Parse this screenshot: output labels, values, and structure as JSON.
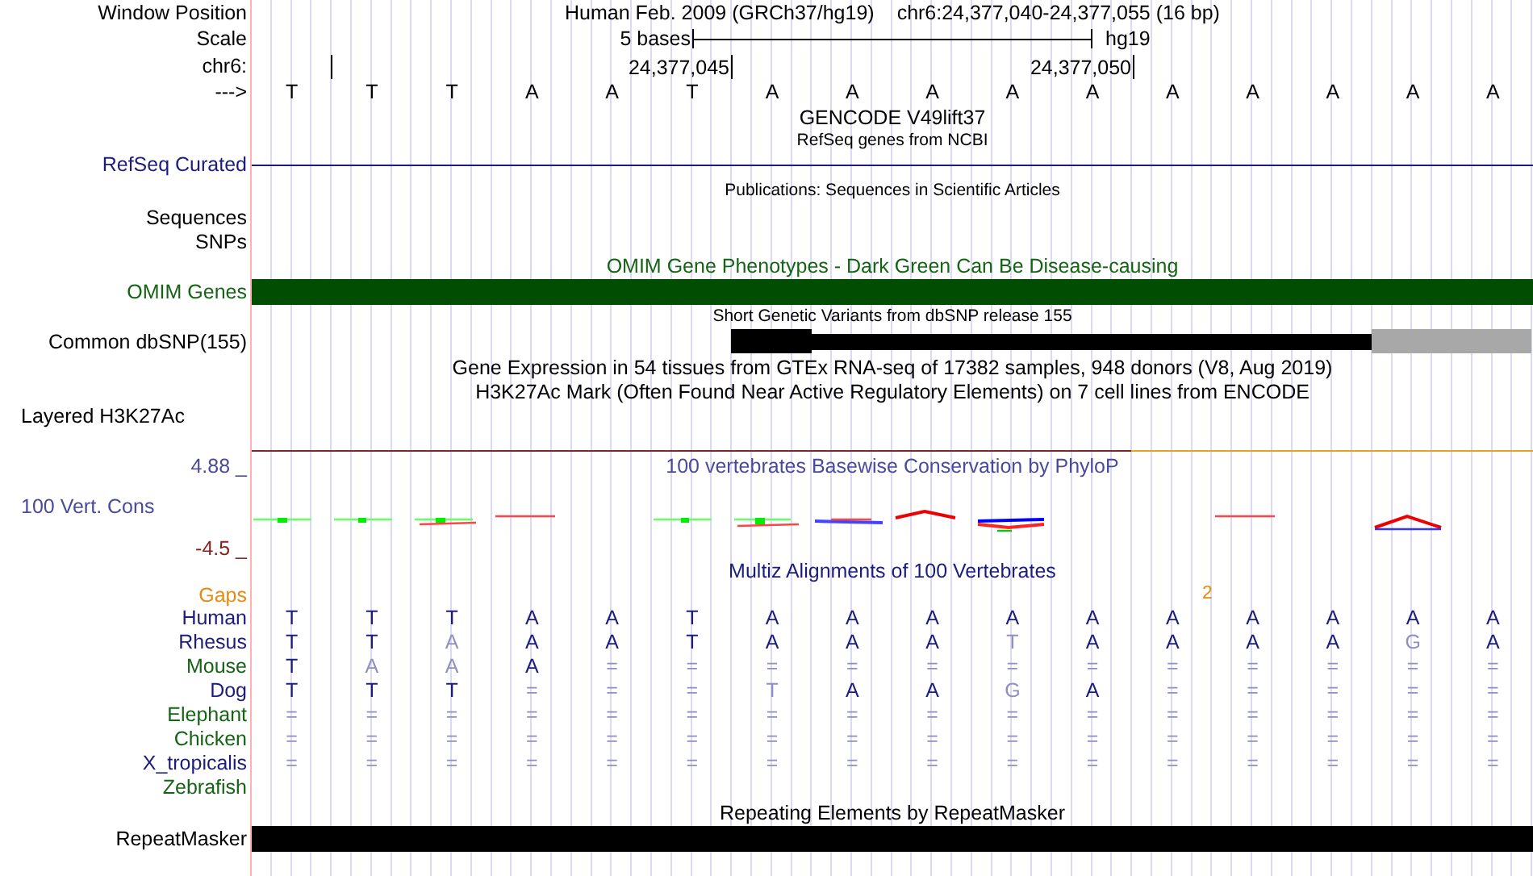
{
  "window_position": {
    "label": "Window Position",
    "assembly": "Human Feb. 2009 (GRCh37/hg19)",
    "position": "chr6:24,377,040-24,377,055 (16 bp)"
  },
  "scale": {
    "label": "Scale",
    "ruler_label": "5 bases",
    "assembly": "hg19"
  },
  "coordinates": {
    "label": "chr6:",
    "ticks": [
      "24,377,045",
      "24,377,050"
    ]
  },
  "sequence": {
    "label": "--->",
    "bases": [
      "T",
      "T",
      "T",
      "A",
      "A",
      "T",
      "A",
      "A",
      "A",
      "A",
      "A",
      "A",
      "A",
      "A",
      "A",
      "A"
    ]
  },
  "gencode": {
    "title": "GENCODE V49lift37",
    "subtitle": "RefSeq genes from NCBI",
    "label": "RefSeq Curated"
  },
  "publications": {
    "title": "Publications: Sequences in Scientific Articles",
    "labels": [
      "Sequences",
      "SNPs"
    ]
  },
  "omim": {
    "title": "OMIM Gene Phenotypes - Dark Green Can Be Disease-causing",
    "label": "OMIM Genes"
  },
  "dbsnp": {
    "title": "Short Genetic Variants from dbSNP release 155",
    "label": "Common dbSNP(155)"
  },
  "gtex": {
    "title": "Gene Expression in 54 tissues from GTEx RNA-seq of 17382 samples, 948 donors (V8, Aug 2019)"
  },
  "h3k27ac": {
    "title": "H3K27Ac Mark (Often Found Near Active Regulatory Elements) on 7 cell lines from ENCODE",
    "label": "Layered H3K27Ac"
  },
  "conservation": {
    "title": "100 vertebrates Basewise Conservation by PhyloP",
    "label": "100 Vert. Cons",
    "max": "4.88 _",
    "min": "-4.5 _"
  },
  "multiz": {
    "title": "Multiz Alignments of 100 Vertebrates",
    "gaps_label": "Gaps",
    "gap_count": "2",
    "species": [
      {
        "name": "Human",
        "color": "#1c1c7c",
        "bases": [
          {
            "base": "T",
            "match": true
          },
          {
            "base": "T",
            "match": true
          },
          {
            "base": "T",
            "match": true
          },
          {
            "base": "A",
            "match": true
          },
          {
            "base": "A",
            "match": true
          },
          {
            "base": "T",
            "match": true
          },
          {
            "base": "A",
            "match": true
          },
          {
            "base": "A",
            "match": true
          },
          {
            "base": "A",
            "match": true
          },
          {
            "base": "A",
            "match": true
          },
          {
            "base": "A",
            "match": true
          },
          {
            "base": "A",
            "match": true
          },
          {
            "base": "A",
            "match": true
          },
          {
            "base": "A",
            "match": true
          },
          {
            "base": "A",
            "match": true
          },
          {
            "base": "A",
            "match": true
          }
        ]
      },
      {
        "name": "Rhesus",
        "color": "#1c1c7c",
        "bases": [
          {
            "base": "T",
            "match": true
          },
          {
            "base": "T",
            "match": true
          },
          {
            "base": "A",
            "match": false
          },
          {
            "base": "A",
            "match": true
          },
          {
            "base": "A",
            "match": true
          },
          {
            "base": "T",
            "match": true
          },
          {
            "base": "A",
            "match": true
          },
          {
            "base": "A",
            "match": true
          },
          {
            "base": "A",
            "match": true
          },
          {
            "base": "T",
            "match": false
          },
          {
            "base": "A",
            "match": true
          },
          {
            "base": "A",
            "match": true
          },
          {
            "base": "A",
            "match": true
          },
          {
            "base": "A",
            "match": true
          },
          {
            "base": "G",
            "match": false
          },
          {
            "base": "A",
            "match": true
          }
        ]
      },
      {
        "name": "Mouse",
        "color": "#146414",
        "bases": [
          {
            "base": "T",
            "match": true
          },
          {
            "base": "A",
            "match": false
          },
          {
            "base": "A",
            "match": false
          },
          {
            "base": "A",
            "match": true
          },
          {
            "base": "=",
            "match": false
          },
          {
            "base": "=",
            "match": false
          },
          {
            "base": "=",
            "match": false
          },
          {
            "base": "=",
            "match": false
          },
          {
            "base": "=",
            "match": false
          },
          {
            "base": "=",
            "match": false
          },
          {
            "base": "=",
            "match": false
          },
          {
            "base": "=",
            "match": false
          },
          {
            "base": "=",
            "match": false
          },
          {
            "base": "=",
            "match": false
          },
          {
            "base": "=",
            "match": false
          },
          {
            "base": "=",
            "match": false
          }
        ]
      },
      {
        "name": "Dog",
        "color": "#1c1c7c",
        "bases": [
          {
            "base": "T",
            "match": true
          },
          {
            "base": "T",
            "match": true
          },
          {
            "base": "T",
            "match": true
          },
          {
            "base": "=",
            "match": false
          },
          {
            "base": "=",
            "match": false
          },
          {
            "base": "=",
            "match": false
          },
          {
            "base": "T",
            "match": false
          },
          {
            "base": "A",
            "match": true
          },
          {
            "base": "A",
            "match": true
          },
          {
            "base": "G",
            "match": false
          },
          {
            "base": "A",
            "match": true
          },
          {
            "base": "=",
            "match": false
          },
          {
            "base": "=",
            "match": false
          },
          {
            "base": "=",
            "match": false
          },
          {
            "base": "=",
            "match": false
          },
          {
            "base": "=",
            "match": false
          }
        ]
      },
      {
        "name": "Elephant",
        "color": "#146414",
        "bases": [
          {
            "base": "=",
            "match": false
          },
          {
            "base": "=",
            "match": false
          },
          {
            "base": "=",
            "match": false
          },
          {
            "base": "=",
            "match": false
          },
          {
            "base": "=",
            "match": false
          },
          {
            "base": "=",
            "match": false
          },
          {
            "base": "=",
            "match": false
          },
          {
            "base": "=",
            "match": false
          },
          {
            "base": "=",
            "match": false
          },
          {
            "base": "=",
            "match": false
          },
          {
            "base": "=",
            "match": false
          },
          {
            "base": "=",
            "match": false
          },
          {
            "base": "=",
            "match": false
          },
          {
            "base": "=",
            "match": false
          },
          {
            "base": "=",
            "match": false
          },
          {
            "base": "=",
            "match": false
          }
        ]
      },
      {
        "name": "Chicken",
        "color": "#146414",
        "bases": [
          {
            "base": "=",
            "match": false
          },
          {
            "base": "=",
            "match": false
          },
          {
            "base": "=",
            "match": false
          },
          {
            "base": "=",
            "match": false
          },
          {
            "base": "=",
            "match": false
          },
          {
            "base": "=",
            "match": false
          },
          {
            "base": "=",
            "match": false
          },
          {
            "base": "=",
            "match": false
          },
          {
            "base": "=",
            "match": false
          },
          {
            "base": "=",
            "match": false
          },
          {
            "base": "=",
            "match": false
          },
          {
            "base": "=",
            "match": false
          },
          {
            "base": "=",
            "match": false
          },
          {
            "base": "=",
            "match": false
          },
          {
            "base": "=",
            "match": false
          },
          {
            "base": "=",
            "match": false
          }
        ]
      },
      {
        "name": "X_tropicalis",
        "color": "#1c1c7c",
        "bases": [
          {
            "base": "=",
            "match": false
          },
          {
            "base": "=",
            "match": false
          },
          {
            "base": "=",
            "match": false
          },
          {
            "base": "=",
            "match": false
          },
          {
            "base": "=",
            "match": false
          },
          {
            "base": "=",
            "match": false
          },
          {
            "base": "=",
            "match": false
          },
          {
            "base": "=",
            "match": false
          },
          {
            "base": "=",
            "match": false
          },
          {
            "base": "=",
            "match": false
          },
          {
            "base": "=",
            "match": false
          },
          {
            "base": "=",
            "match": false
          },
          {
            "base": "=",
            "match": false
          },
          {
            "base": "=",
            "match": false
          },
          {
            "base": "=",
            "match": false
          },
          {
            "base": "=",
            "match": false
          }
        ]
      },
      {
        "name": "Zebrafish",
        "color": "#146414"
      }
    ]
  },
  "repeatmasker": {
    "title": "Repeating Elements by RepeatMasker",
    "label": "RepeatMasker"
  }
}
